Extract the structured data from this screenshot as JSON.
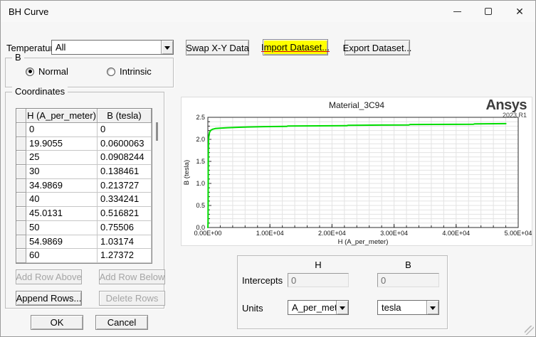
{
  "window": {
    "title": "BH Curve"
  },
  "temperature": {
    "label": "Temperature",
    "value": "All"
  },
  "b_group": {
    "label": "B",
    "options": [
      {
        "label": "Normal",
        "selected": true
      },
      {
        "label": "Intrinsic",
        "selected": false
      }
    ]
  },
  "toolbar": {
    "swap": "Swap X-Y Data",
    "import": "Import Dataset...",
    "export": "Export Dataset...",
    "import_highlight": "#ffff00"
  },
  "coordinates": {
    "label": "Coordinates",
    "columns": [
      "H (A_per_meter)",
      "B (tesla)"
    ],
    "rows": [
      [
        "0",
        "0"
      ],
      [
        "19.9055",
        "0.0600063"
      ],
      [
        "25",
        "0.0908244"
      ],
      [
        "30",
        "0.138461"
      ],
      [
        "34.9869",
        "0.213727"
      ],
      [
        "40",
        "0.334241"
      ],
      [
        "45.0131",
        "0.516821"
      ],
      [
        "50",
        "0.75506"
      ],
      [
        "54.9869",
        "1.03174"
      ],
      [
        "60",
        "1.27372"
      ]
    ],
    "buttons": {
      "add_above": "Add Row Above",
      "add_below": "Add Row Below",
      "append": "Append Rows...",
      "delete": "Delete Rows"
    }
  },
  "actions": {
    "ok": "OK",
    "cancel": "Cancel"
  },
  "watermark": {
    "brand": "Ansys",
    "release": "2023 R1"
  },
  "chart_data": {
    "type": "line",
    "title": "Material_3C94",
    "xlabel": "H (A_per_meter)",
    "ylabel": "B (tesla)",
    "xlim": [
      0,
      50000
    ],
    "ylim": [
      0,
      2.5
    ],
    "x_ticks": [
      {
        "v": 0,
        "label": "0.00E+00"
      },
      {
        "v": 10000,
        "label": "1.00E+04"
      },
      {
        "v": 20000,
        "label": "2.00E+04"
      },
      {
        "v": 30000,
        "label": "3.00E+04"
      },
      {
        "v": 40000,
        "label": "4.00E+04"
      },
      {
        "v": 50000,
        "label": "5.00E+04"
      }
    ],
    "y_ticks": [
      {
        "v": 0,
        "label": "0.0"
      },
      {
        "v": 0.5,
        "label": "0.5"
      },
      {
        "v": 1.0,
        "label": "1.0"
      },
      {
        "v": 1.5,
        "label": "1.5"
      },
      {
        "v": 2.0,
        "label": "2.0"
      },
      {
        "v": 2.5,
        "label": "2.5"
      }
    ],
    "minor_x_step": 2000,
    "minor_y_step": 0.1,
    "grid": true,
    "line_color": "#00dd00",
    "series": [
      {
        "name": "Material_3C94",
        "points": [
          [
            0,
            0
          ],
          [
            19.9055,
            0.0600063
          ],
          [
            25,
            0.0908244
          ],
          [
            30,
            0.138461
          ],
          [
            34.9869,
            0.213727
          ],
          [
            40,
            0.334241
          ],
          [
            45.0131,
            0.516821
          ],
          [
            50,
            0.75506
          ],
          [
            54.9869,
            1.03174
          ],
          [
            60,
            1.27372
          ],
          [
            65,
            1.45
          ],
          [
            70,
            1.58
          ],
          [
            80,
            1.74
          ],
          [
            90,
            1.84
          ],
          [
            100,
            1.91
          ],
          [
            120,
            1.99
          ],
          [
            150,
            2.05
          ],
          [
            200,
            2.11
          ],
          [
            300,
            2.17
          ],
          [
            500,
            2.21
          ],
          [
            800,
            2.23
          ],
          [
            1200,
            2.245
          ],
          [
            2000,
            2.255
          ],
          [
            3200,
            2.265
          ],
          [
            5000,
            2.275
          ],
          [
            6400,
            2.28
          ],
          [
            9000,
            2.288
          ],
          [
            12700,
            2.293
          ],
          [
            12900,
            2.303
          ],
          [
            18000,
            2.307
          ],
          [
            22400,
            2.31
          ],
          [
            22600,
            2.32
          ],
          [
            28000,
            2.324
          ],
          [
            32400,
            2.327
          ],
          [
            32600,
            2.337
          ],
          [
            40000,
            2.341
          ],
          [
            42800,
            2.343
          ],
          [
            43000,
            2.352
          ],
          [
            48000,
            2.356
          ]
        ]
      }
    ]
  },
  "footer": {
    "col_h": "H",
    "col_b": "B",
    "intercepts_label": "Intercepts",
    "intercept_h": "0",
    "intercept_b": "0",
    "units_label": "Units",
    "unit_h": "A_per_meter",
    "unit_b": "tesla"
  }
}
